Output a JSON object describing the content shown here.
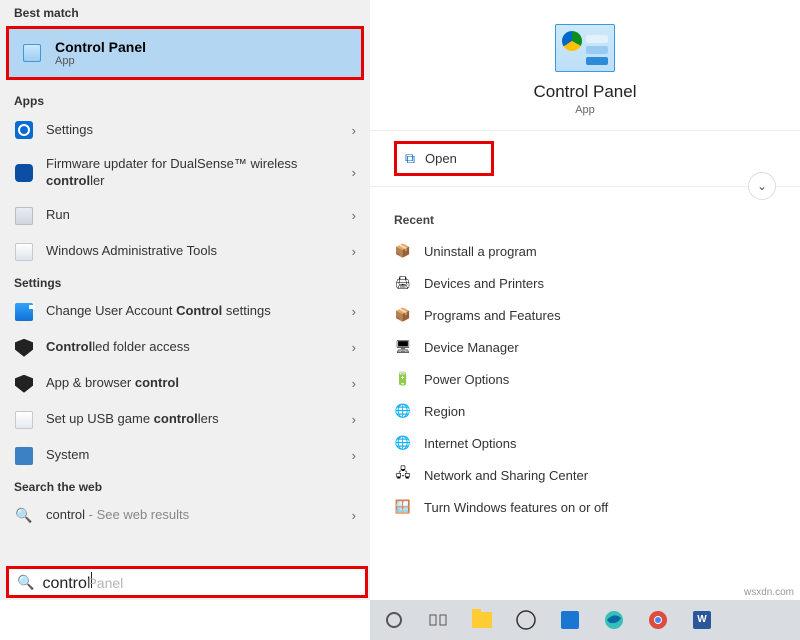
{
  "left": {
    "best_match_label": "Best match",
    "best_match": {
      "title": "Control Panel",
      "sub": "App"
    },
    "apps_label": "Apps",
    "apps": [
      {
        "label": "Settings"
      },
      {
        "label_html": "Firmware updater for DualSense™ wireless <b>control</b>ler"
      },
      {
        "label": "Run"
      },
      {
        "label": "Windows Administrative Tools"
      }
    ],
    "settings_label": "Settings",
    "settings": [
      {
        "label_html": "Change User Account <b>Control</b> settings"
      },
      {
        "label_html": "<b>Control</b>led folder access"
      },
      {
        "label_html": "App & browser <b>control</b>"
      },
      {
        "label_html": "Set up USB game <b>control</b>lers"
      },
      {
        "label": "System"
      }
    ],
    "web_label": "Search the web",
    "web": {
      "prefix": "control",
      "suffix": " - See web results"
    }
  },
  "right": {
    "hero_title": "Control Panel",
    "hero_sub": "App",
    "open_label": "Open",
    "recent_label": "Recent",
    "recent": [
      "Uninstall a program",
      "Devices and Printers",
      "Programs and Features",
      "Device Manager",
      "Power Options",
      "Region",
      "Internet Options",
      "Network and Sharing Center",
      "Turn Windows features on or off"
    ]
  },
  "search": {
    "value": "control",
    "ghost": "Panel"
  },
  "watermark": "wsxdn.com"
}
